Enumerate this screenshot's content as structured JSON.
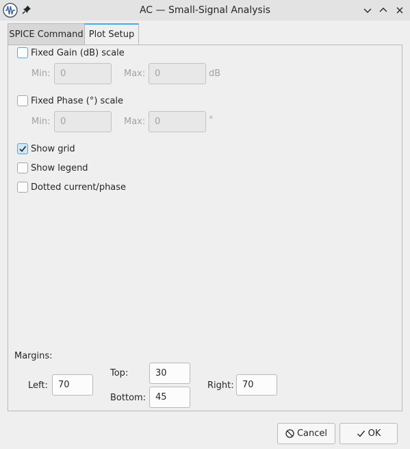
{
  "window": {
    "title": "AC — Small-Signal Analysis"
  },
  "tabs": [
    {
      "label": "SPICE Command",
      "active": false
    },
    {
      "label": "Plot Setup",
      "active": true
    }
  ],
  "plot_setup": {
    "fixed_gain": {
      "label": "Fixed Gain (dB) scale",
      "checked": false,
      "min_label": "Min:",
      "min_value": "0",
      "max_label": "Max:",
      "max_value": "0",
      "unit": "dB"
    },
    "fixed_phase": {
      "label": "Fixed Phase (°) scale",
      "checked": false,
      "min_label": "Min:",
      "min_value": "0",
      "max_label": "Max:",
      "max_value": "0",
      "unit": "°"
    },
    "show_grid": {
      "label": "Show grid",
      "checked": true
    },
    "show_legend": {
      "label": "Show legend",
      "checked": false
    },
    "dotted": {
      "label": "Dotted current/phase",
      "checked": false
    },
    "margins": {
      "heading": "Margins:",
      "left_label": "Left:",
      "left_value": "70",
      "top_label": "Top:",
      "top_value": "30",
      "bottom_label": "Bottom:",
      "bottom_value": "45",
      "right_label": "Right:",
      "right_value": "70"
    }
  },
  "buttons": {
    "cancel": "Cancel",
    "ok": "OK"
  },
  "colors": {
    "accent": "#3daee9",
    "background": "#efefef",
    "titlebar": "#e3e3e3"
  }
}
